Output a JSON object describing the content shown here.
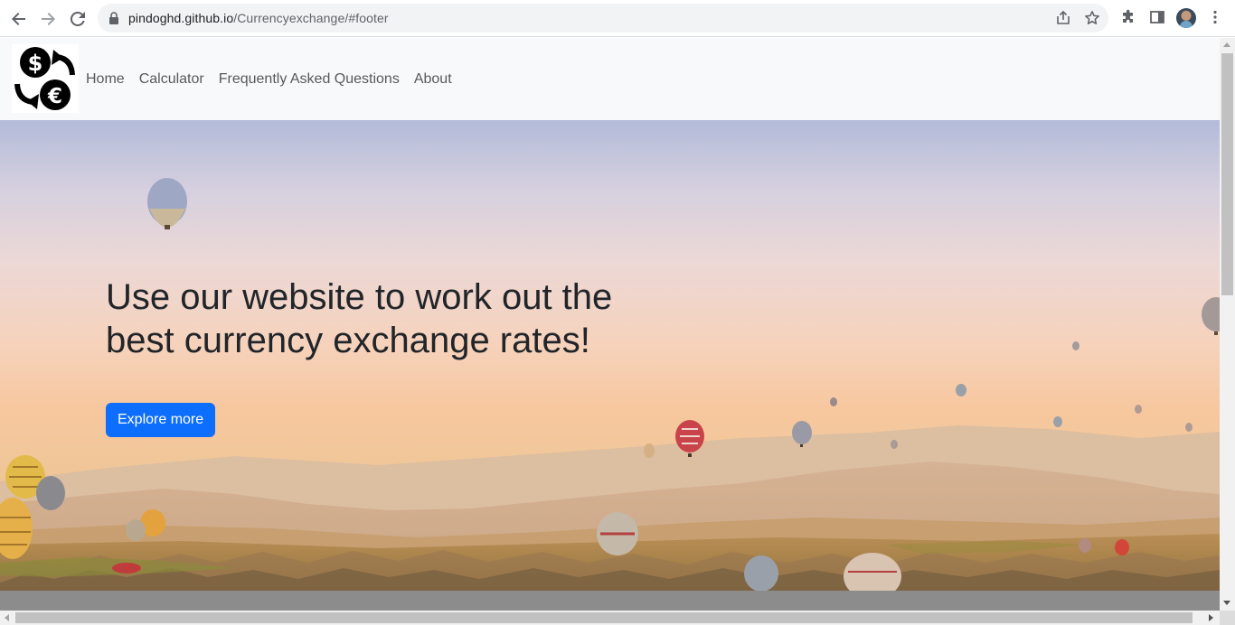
{
  "browser": {
    "url_host": "pindoghd.github.io",
    "url_path": "/Currencyexchange/#footer",
    "icons": [
      "back-arrow-icon",
      "forward-arrow-icon",
      "reload-icon",
      "lock-icon",
      "share-icon",
      "bookmark-star-icon",
      "extensions-puzzle-icon",
      "side-panel-icon",
      "profile-avatar",
      "more-vertical-icon"
    ]
  },
  "site": {
    "logo_icon": "currency-exchange-icon",
    "nav": [
      {
        "label": "Home"
      },
      {
        "label": "Calculator"
      },
      {
        "label": "Frequently Asked Questions"
      },
      {
        "label": "About"
      }
    ]
  },
  "hero": {
    "title": "Use our website to work out the best currency exchange rates!",
    "button_label": "Explore more",
    "button_color": "#0d6efd",
    "background": "hot-air-balloons-landscape-image"
  },
  "colors": {
    "nav_bg": "#f8f9fa",
    "title_text": "#212529"
  }
}
